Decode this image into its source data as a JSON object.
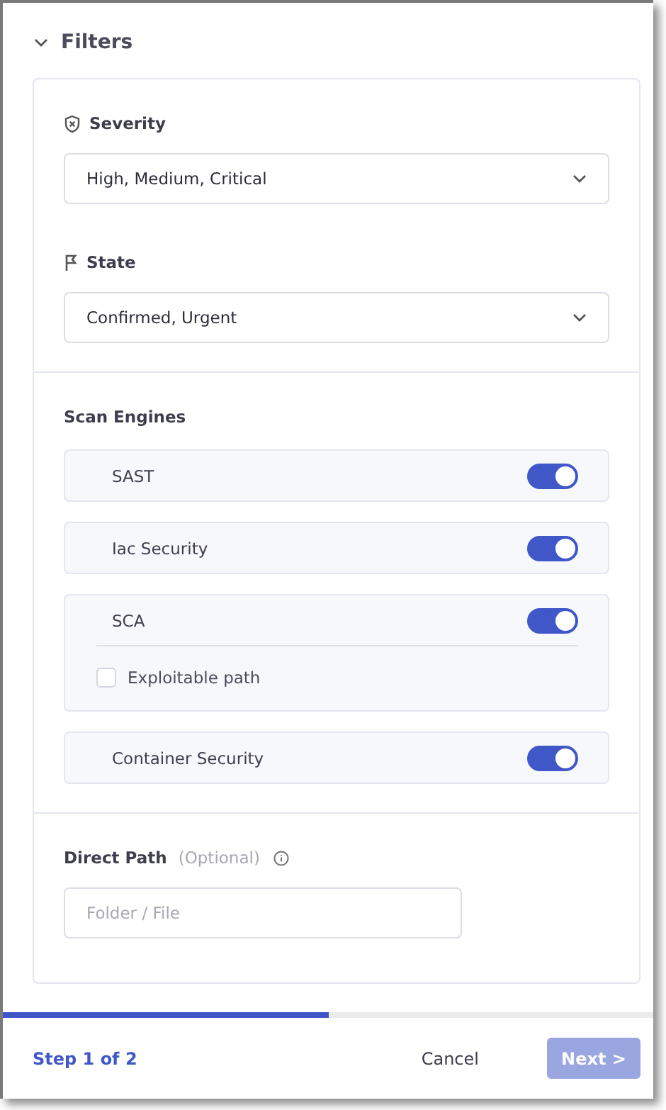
{
  "header": {
    "title": "Filters",
    "expanded": true
  },
  "dropdowns": [
    {
      "label": "Severity",
      "value": "High, Medium, Critical"
    },
    {
      "label": "State",
      "value": "Confirmed, Urgent"
    }
  ],
  "scan_engines": {
    "title": "Scan Engines",
    "engines": [
      {
        "name": "SAST",
        "on": true
      },
      {
        "name": "Iac Security",
        "on": true
      },
      {
        "name": "SCA",
        "on": true,
        "options": [
          {
            "label": "Exploitable path",
            "checked": false
          }
        ]
      },
      {
        "name": "Container Security",
        "on": true
      }
    ]
  },
  "direct_path": {
    "label": "Direct Path",
    "hint": "(Optional)",
    "placeholder": "Folder / File"
  },
  "progress": {
    "level": 0.5
  },
  "footer": {
    "step": "Step 1 of 2",
    "cancel": "Cancel",
    "next": {
      "label": "Next >",
      "disabled": true
    }
  }
}
